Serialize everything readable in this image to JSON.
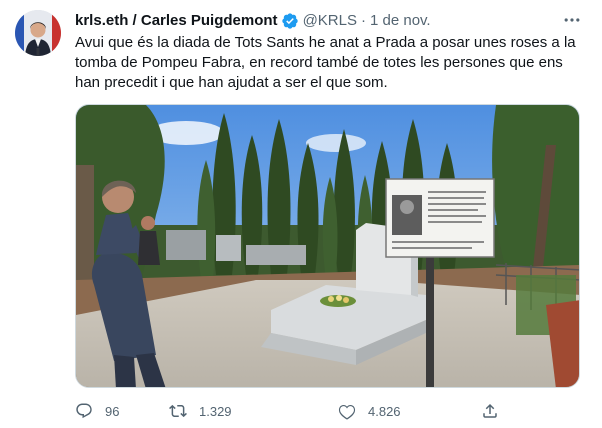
{
  "tweet": {
    "display_name": "krls.eth / Carles Puigdemont",
    "handle": "@KRLS",
    "separator": "·",
    "timestamp": "1 de nov.",
    "text": "Avui que és la diada de Tots Sants he anat a Prada a posar unes roses a la tomba de Pompeu Fabra, en record també de totes les persones que ens han precedit i que han ajudat a ser el que som.",
    "more_icon": "more-horizontal-icon",
    "verified_icon": "verified-badge-icon"
  },
  "actions": {
    "replies": "96",
    "retweets": "1.329",
    "likes": "4.826"
  },
  "colors": {
    "accent": "#1d9bf0",
    "secondary_text": "#536471",
    "primary_text": "#0f1419"
  }
}
